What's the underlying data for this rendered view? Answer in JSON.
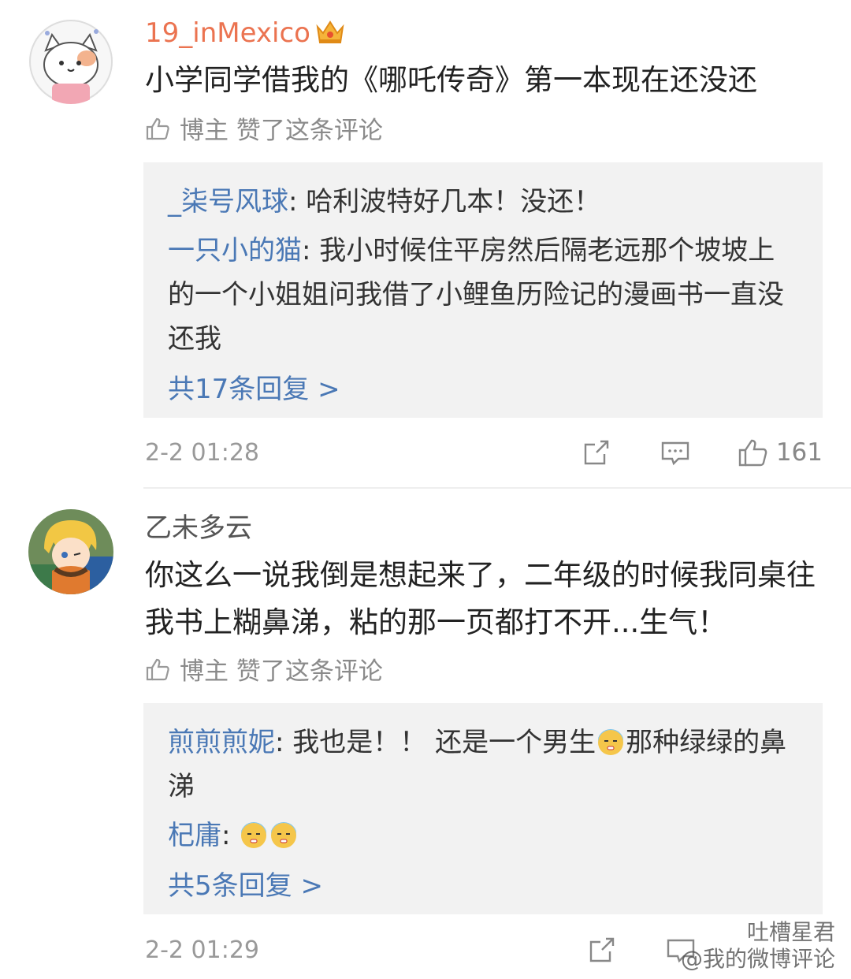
{
  "comments": [
    {
      "username": "19_inMexico",
      "text": "小学同学借我的《哪吒传奇》第一本现在还没还",
      "liked_by_author": "博主 赞了这条评论",
      "replies": [
        {
          "user": "_柒号风球",
          "sep": ": ",
          "text": "哈利波特好几本！没还！"
        },
        {
          "user": "一只小的猫",
          "sep": ": ",
          "text": "我小时候住平房然后隔老远那个坡坡上的一个小姐姐问我借了小鲤鱼历险记的漫画书一直没还我"
        }
      ],
      "more_replies": "共17条回复 >",
      "time": "2-2 01:28",
      "like_count": "161"
    },
    {
      "username": "乙未多云",
      "text": "你这么一说我倒是想起来了，二年级的时候我同桌往我书上糊鼻涕，粘的那一页都打不开...生气！",
      "liked_by_author": "博主 赞了这条评论",
      "replies": [
        {
          "user": "煎煎煎妮",
          "sep": ": ",
          "text_before": "我也是！！ 还是一个男生",
          "emoji": "sick-face",
          "text_after": "那种绿绿的鼻涕"
        },
        {
          "user": "杞庸",
          "sep": ": ",
          "emojis": [
            "sick-face",
            "sick-face"
          ]
        }
      ],
      "more_replies": "共5条回复 >",
      "time": "2-2 01:29"
    }
  ],
  "watermark": {
    "line1": "吐槽星君",
    "line2": "@我的微博评论"
  },
  "colors": {
    "vip_name": "#eb7350",
    "link": "#4a78b5",
    "reply_bg": "#f2f2f2",
    "meta": "#999999"
  }
}
